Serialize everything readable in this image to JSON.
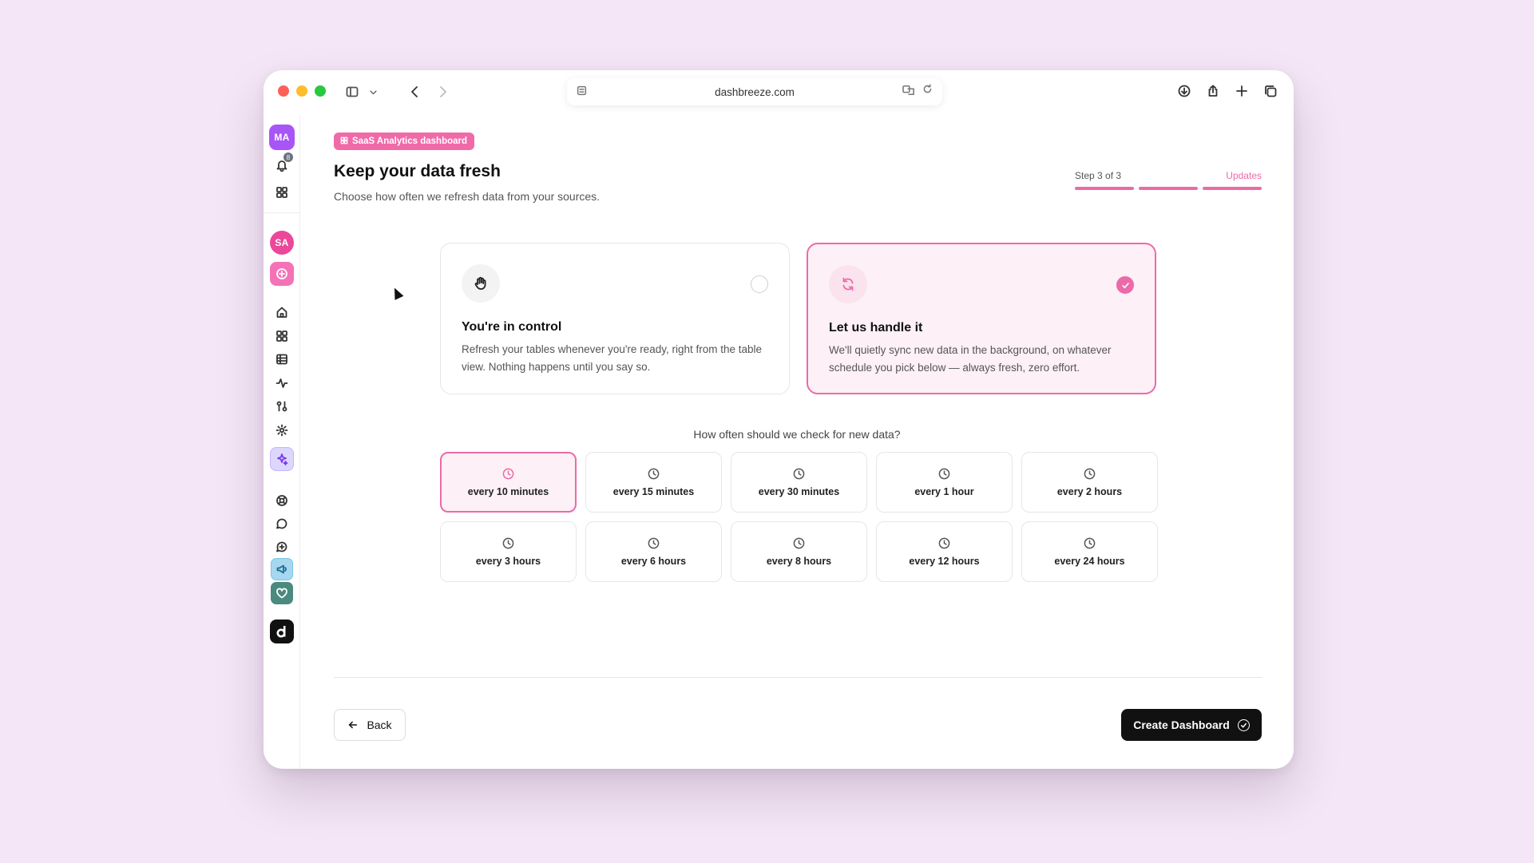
{
  "browser": {
    "url": "dashbreeze.com"
  },
  "sidebar": {
    "user_initials": "MA",
    "notification_count": "8",
    "workspace_initials": "SA"
  },
  "header": {
    "tag_label": "SaaS Analytics dashboard",
    "title": "Keep your data fresh",
    "subtitle": "Choose how often we refresh data from your sources.",
    "step_label": "Step 3 of 3",
    "step_name": "Updates",
    "steps_completed": 3,
    "steps_total": 3
  },
  "options": [
    {
      "icon": "hand-icon",
      "title": "You're in control",
      "description": "Refresh your tables whenever you're ready, right from the table view. Nothing happens until you say so.",
      "selected": false
    },
    {
      "icon": "refresh-icon",
      "title": "Let us handle it",
      "description": "We'll quietly sync new data in the background, on whatever schedule you pick below — always fresh, zero effort.",
      "selected": true
    }
  ],
  "frequency": {
    "question": "How often should we check for new data?",
    "selected": "every 10 minutes",
    "items": [
      "every 10 minutes",
      "every 15 minutes",
      "every 30 minutes",
      "every 1 hour",
      "every 2 hours",
      "every 3 hours",
      "every 6 hours",
      "every 8 hours",
      "every 12 hours",
      "every 24 hours"
    ]
  },
  "footer": {
    "back_label": "Back",
    "create_label": "Create Dashboard"
  },
  "colors": {
    "accent": "#ec6aa8",
    "background": "#f4e6f6"
  }
}
